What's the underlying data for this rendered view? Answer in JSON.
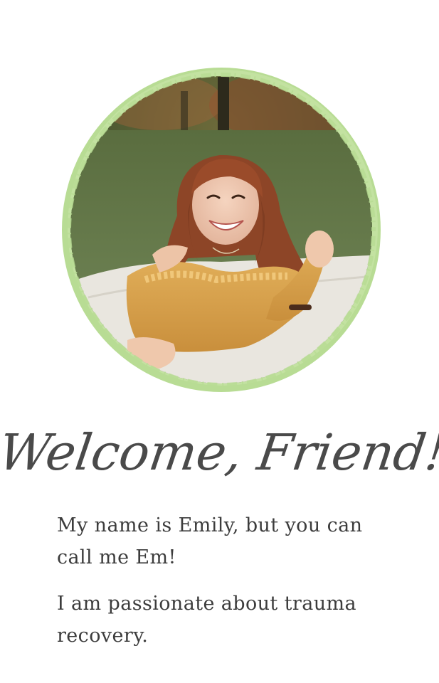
{
  "hero": {
    "photo_alt": "Smiling woman with long auburn hair in a mustard off-shoulder top lying on a white blanket on the grass",
    "frame_color": "#b8dc94"
  },
  "headline": {
    "text": "Welcome, Friend!",
    "color": "#4a4a4a"
  },
  "intro": {
    "paragraph_1": "My name is Emily, but you can call me Em!",
    "paragraph_2": "I am passionate about trauma recovery."
  }
}
